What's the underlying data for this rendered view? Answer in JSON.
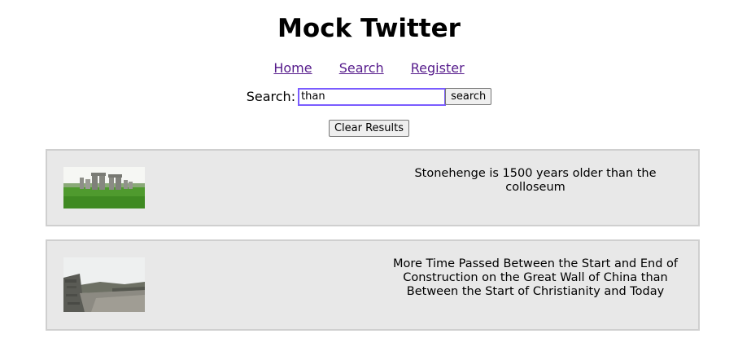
{
  "header": {
    "title": "Mock Twitter"
  },
  "nav": {
    "items": [
      {
        "label": "Home"
      },
      {
        "label": "Search"
      },
      {
        "label": "Register"
      }
    ]
  },
  "search": {
    "label": "Search:",
    "value": "than",
    "button_label": "search"
  },
  "clear": {
    "button_label": "Clear Results"
  },
  "results": [
    {
      "text": "Stonehenge is 1500 years older than the colloseum",
      "image": "stonehenge-photo"
    },
    {
      "text": "More Time Passed Between the Start and End of Construction on the Great Wall of China than Between the Start of Christianity and Today",
      "image": "great-wall-photo"
    }
  ],
  "colors": {
    "link": "#551a8b",
    "card_background": "#e8e8e8",
    "card_border": "#cfcfcf",
    "input_focus": "#7a5cff"
  }
}
